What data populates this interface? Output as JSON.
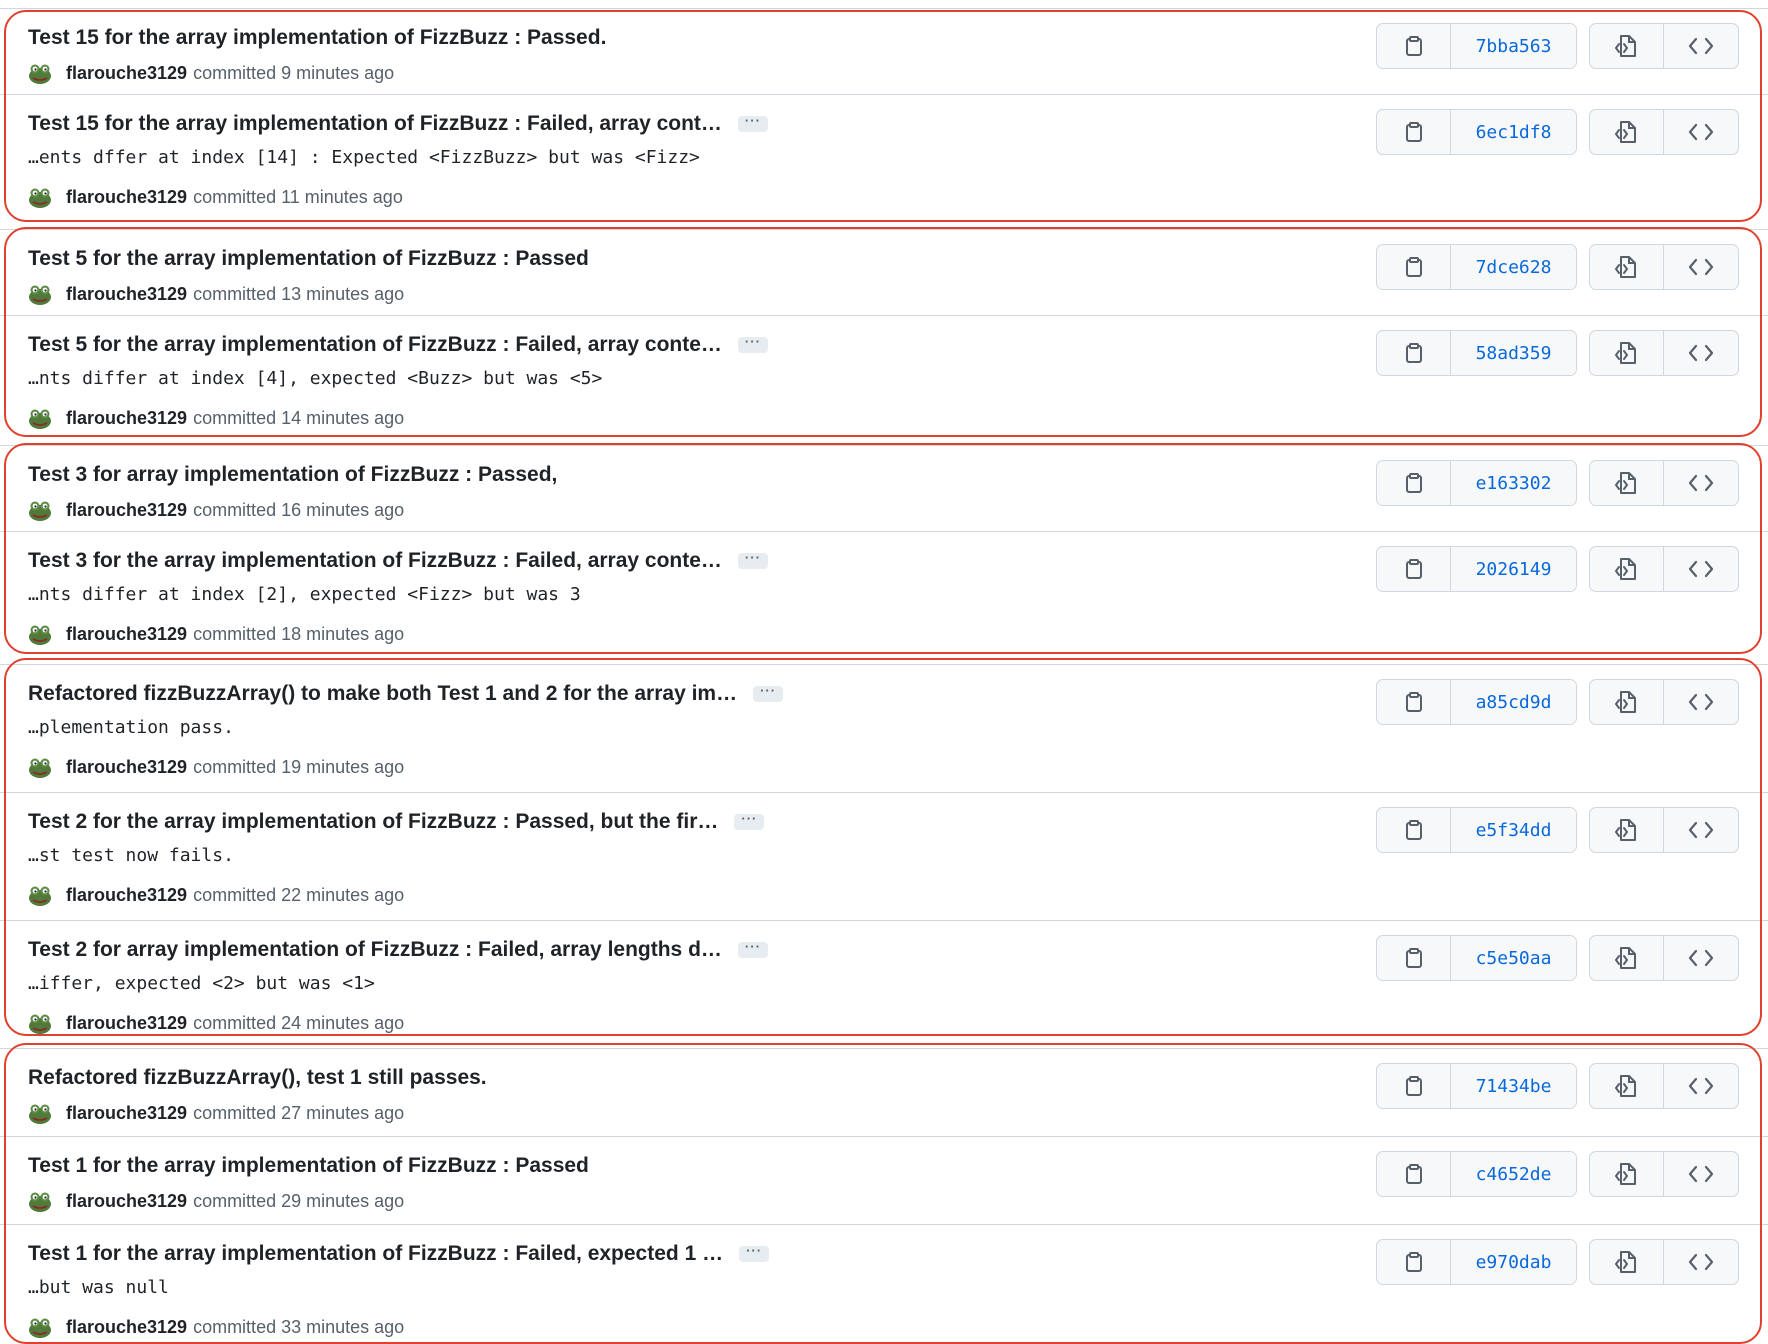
{
  "commits": [
    {
      "title": "Test 15 for the array implementation of FizzBuzz : Passed.",
      "has_more": false,
      "description": "",
      "author": "flarouche3129",
      "time": "committed 9 minutes ago",
      "sha": "7bba563"
    },
    {
      "title": "Test 15 for the array implementation of FizzBuzz : Failed, array cont…",
      "has_more": true,
      "description": "…ents dffer at index [14] : Expected <FizzBuzz> but was <Fizz>",
      "author": "flarouche3129",
      "time": "committed 11 minutes ago",
      "sha": "6ec1df8"
    },
    {
      "title": "Test 5 for the array implementation of FizzBuzz : Passed",
      "has_more": false,
      "description": "",
      "author": "flarouche3129",
      "time": "committed 13 minutes ago",
      "sha": "7dce628"
    },
    {
      "title": "Test 5 for the array implementation of FizzBuzz : Failed, array conte…",
      "has_more": true,
      "description": "…nts differ at index [4], expected <Buzz> but was <5>",
      "author": "flarouche3129",
      "time": "committed 14 minutes ago",
      "sha": "58ad359"
    },
    {
      "title": "Test 3 for array implementation of FizzBuzz : Passed,",
      "has_more": false,
      "description": "",
      "author": "flarouche3129",
      "time": "committed 16 minutes ago",
      "sha": "e163302"
    },
    {
      "title": "Test 3 for the array implementation of FizzBuzz : Failed, array conte…",
      "has_more": true,
      "description": "…nts differ at index [2], expected <Fizz> but was 3",
      "author": "flarouche3129",
      "time": "committed 18 minutes ago",
      "sha": "2026149"
    },
    {
      "title": "Refactored fizzBuzzArray() to make both Test 1 and 2 for the array im…",
      "has_more": true,
      "description": "…plementation pass.",
      "author": "flarouche3129",
      "time": "committed 19 minutes ago",
      "sha": "a85cd9d"
    },
    {
      "title": "Test 2 for the array implementation of FizzBuzz : Passed, but the fir…",
      "has_more": true,
      "description": "…st test now fails.",
      "author": "flarouche3129",
      "time": "committed 22 minutes ago",
      "sha": "e5f34dd"
    },
    {
      "title": "Test 2 for array implementation of FizzBuzz : Failed, array lengths d…",
      "has_more": true,
      "description": "…iffer, expected <2> but was <1>",
      "author": "flarouche3129",
      "time": "committed 24 minutes ago",
      "sha": "c5e50aa"
    },
    {
      "title": "Refactored fizzBuzzArray(), test 1 still passes.",
      "has_more": false,
      "description": "",
      "author": "flarouche3129",
      "time": "committed 27 minutes ago",
      "sha": "71434be"
    },
    {
      "title": "Test 1 for the array implementation of FizzBuzz : Passed",
      "has_more": false,
      "description": "",
      "author": "flarouche3129",
      "time": "committed 29 minutes ago",
      "sha": "c4652de"
    },
    {
      "title": "Test 1 for the array implementation of FizzBuzz : Failed, expected 1 …",
      "has_more": true,
      "description": "…but was null",
      "author": "flarouche3129",
      "time": "committed 33 minutes ago",
      "sha": "e970dab"
    }
  ],
  "ellipsis_label": "···",
  "colors": {
    "accent": "#0969da",
    "highlight_border": "#e0402c",
    "muted": "#57606a",
    "border": "#d0d7de"
  },
  "icons": {
    "copy": "clipboard-icon",
    "browse": "file-code-icon",
    "code": "code-icon",
    "avatar": "frog-avatar"
  }
}
